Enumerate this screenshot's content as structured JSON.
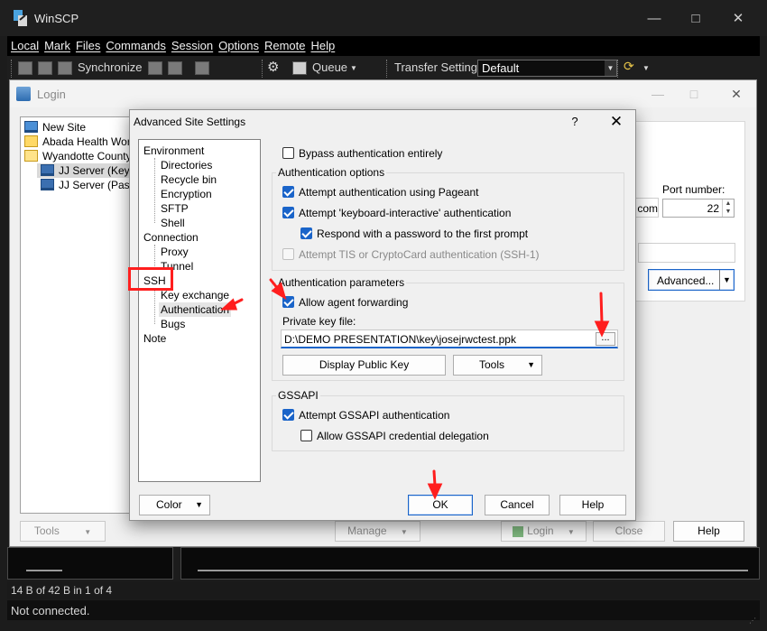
{
  "main_window": {
    "title": "WinSCP",
    "menu": [
      "Local",
      "Mark",
      "Files",
      "Commands",
      "Session",
      "Options",
      "Remote",
      "Help"
    ],
    "toolbar": {
      "synchronize": "Synchronize",
      "queue": "Queue",
      "transfer_settings_label": "Transfer Settings",
      "transfer_settings_value": "Default"
    },
    "status_bar": {
      "selection": "14 B of 42 B in 1 of 4",
      "connection": "Not connected."
    }
  },
  "login_window": {
    "title": "Login",
    "sites": [
      {
        "label": "New Site",
        "icon": "new-site-icon"
      },
      {
        "label": "Abada Health Works",
        "icon": "folder-icon"
      },
      {
        "label": "Wyandotte County",
        "icon": "folder-open-icon"
      },
      {
        "label": "JJ Server (Key-b",
        "icon": "monitor-icon"
      },
      {
        "label": "JJ Server (Passw",
        "icon": "monitor-icon"
      }
    ],
    "host_fragment": "com",
    "port_label": "Port number:",
    "port_value": "22",
    "advanced_button": "Advanced...",
    "buttons": {
      "tools": "Tools",
      "manage": "Manage",
      "login": "Login",
      "close": "Close",
      "help": "Help"
    }
  },
  "advanced_dialog": {
    "title": "Advanced Site Settings",
    "help_glyph": "?",
    "close_glyph": "✕",
    "nav": {
      "environment": "Environment",
      "directories": "Directories",
      "recycle_bin": "Recycle bin",
      "encryption": "Encryption",
      "sftp": "SFTP",
      "shell": "Shell",
      "connection": "Connection",
      "proxy": "Proxy",
      "tunnel": "Tunnel",
      "ssh": "SSH",
      "key_exchange": "Key exchange",
      "authentication": "Authentication",
      "bugs": "Bugs",
      "note": "Note"
    },
    "bypass_auth": {
      "label": "Bypass authentication entirely",
      "checked": false
    },
    "auth_options": {
      "title": "Authentication options",
      "pageant": {
        "label": "Attempt authentication using Pageant",
        "checked": true
      },
      "keyboard_interactive": {
        "label": "Attempt 'keyboard-interactive' authentication",
        "checked": true
      },
      "respond_password": {
        "label": "Respond with a password to the first prompt",
        "checked": true
      },
      "tis": {
        "label": "Attempt TIS or CryptoCard authentication (SSH-1)",
        "checked": false
      }
    },
    "auth_params": {
      "title": "Authentication parameters",
      "agent_forwarding": {
        "label": "Allow agent forwarding",
        "checked": true
      },
      "private_key_label": "Private key file:",
      "private_key_value": "D:\\DEMO PRESENTATION\\key\\josejrwctest.ppk",
      "browse": "...",
      "display_public_key": "Display Public Key",
      "tools": "Tools"
    },
    "gssapi": {
      "title": "GSSAPI",
      "attempt": {
        "label": "Attempt GSSAPI authentication",
        "checked": true
      },
      "delegation": {
        "label": "Allow GSSAPI credential delegation",
        "checked": false
      }
    },
    "buttons": {
      "color": "Color",
      "ok": "OK",
      "cancel": "Cancel",
      "help": "Help"
    }
  },
  "colors": {
    "accent": "#1a64c9",
    "annotation": "#ff1e1e",
    "dark_bg": "#1c1c1c"
  }
}
